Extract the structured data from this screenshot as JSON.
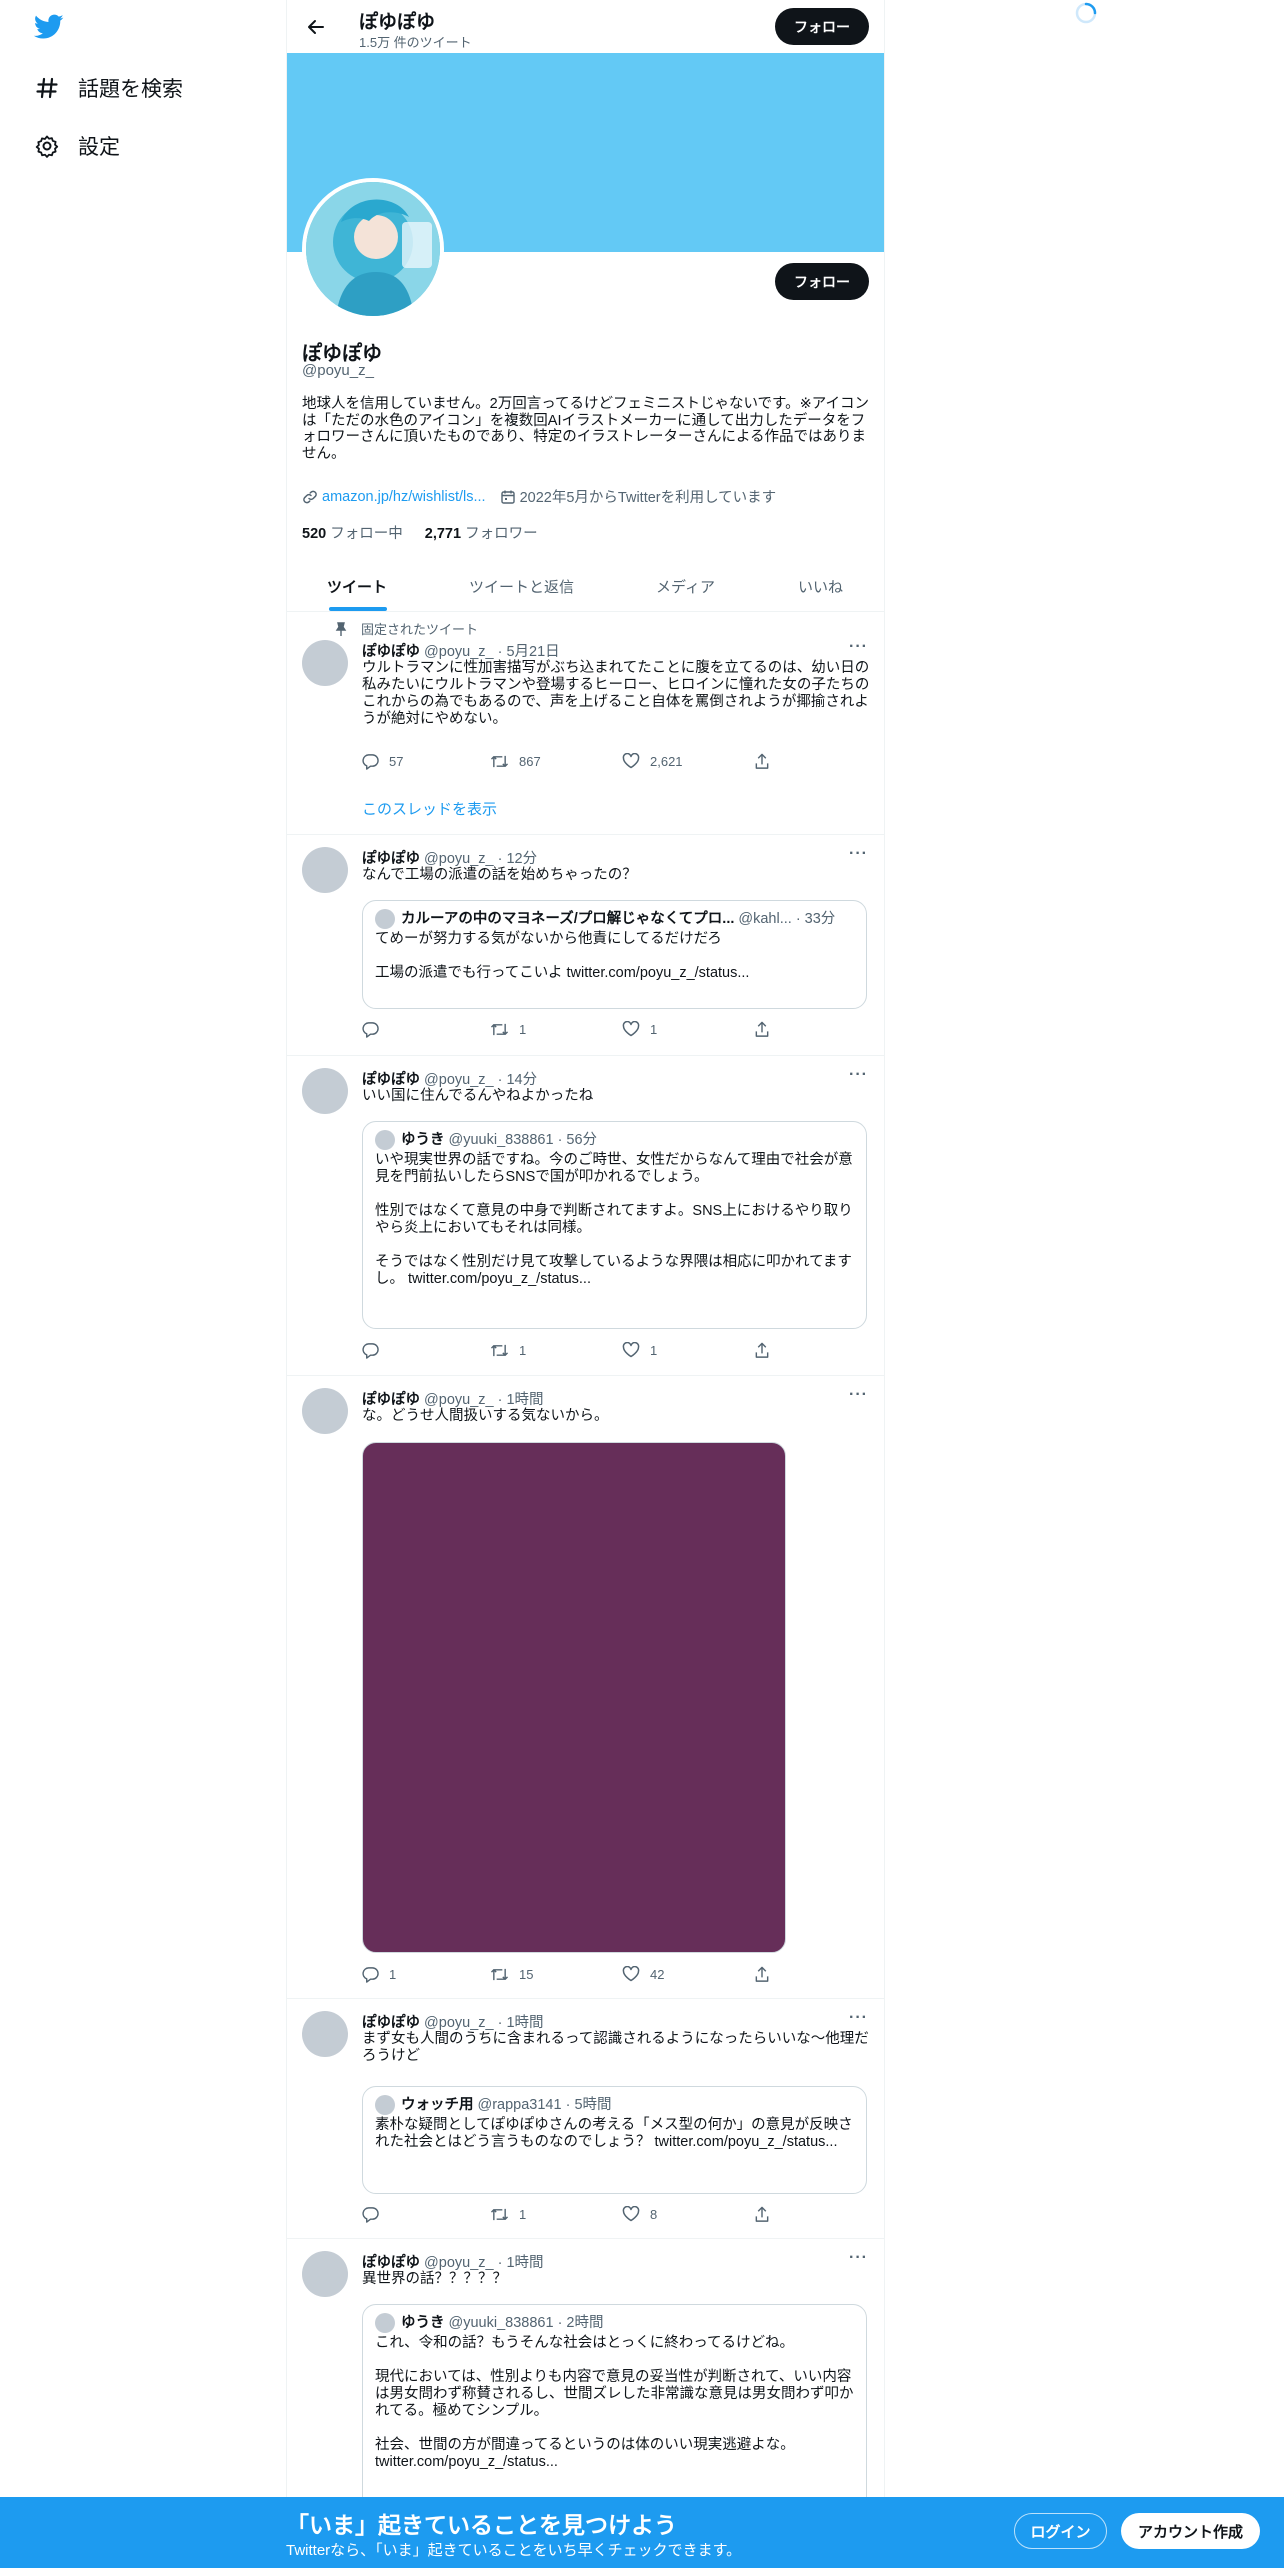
{
  "nav": {
    "explore_label": "話題を検索",
    "settings_label": "設定"
  },
  "header": {
    "name": "ぽゆぽゆ",
    "tweet_count": "1.5万 件のツイート",
    "follow_label": "フォロー"
  },
  "profile": {
    "name": "ぽゆぽゆ",
    "handle": "@poyu_z_",
    "follow_label": "フォロー",
    "bio": "地球人を信用していません。2万回言ってるけどフェミニストじゃないです。※アイコンは「ただの水色のアイコン」を複数回AIイラストメーカーに通して出力したデータをフォロワーさんに頂いたものであり、特定のイラストレーターさんによる作品ではありません。",
    "link": "amazon.jp/hz/wishlist/ls...",
    "joined": "2022年5月からTwitterを利用しています",
    "following_count": "520",
    "following_label": "フォロー中",
    "followers_count": "2,771",
    "followers_label": "フォロワー"
  },
  "tabs": [
    "ツイート",
    "ツイートと返信",
    "メディア",
    "いいね"
  ],
  "tweets": [
    {
      "pinned_label": "固定されたツイート",
      "name": "ぽゆぽゆ",
      "handle": "@poyu_z_",
      "time": "· 5月21日",
      "text": "ウルトラマンに性加害描写がぶち込まれてたことに腹を立てるのは、幼い日の私みたいにウルトラマンや登場するヒーロー、ヒロインに憧れた女の子たちのこれからの為でもあるので、声を上げること自体を罵倒されようが揶揄されようが絶対にやめない。",
      "replies": "57",
      "retweets": "867",
      "likes": "2,621",
      "show_thread": "このスレッドを表示"
    },
    {
      "name": "ぽゆぽゆ",
      "handle": "@poyu_z_",
      "time": "· 12分",
      "text": "なんで工場の派遣の話を始めちゃったの？",
      "quote": {
        "name": "カルーアの中のマヨネーズ/プロ解じゃなくてプロ...",
        "handle": "@kahl...",
        "time": "· 33分",
        "text1": "てめーが努力する気がないから他責にしてるだけだろ",
        "text2": "工場の派遣でも行ってこいよ twitter.com/poyu_z_/status..."
      },
      "replies": "",
      "retweets": "1",
      "likes": "1"
    },
    {
      "name": "ぽゆぽゆ",
      "handle": "@poyu_z_",
      "time": "· 14分",
      "text": "いい国に住んでるんやねよかったね",
      "quote": {
        "name": "ゆうき",
        "handle": "@yuuki_838861",
        "time": "· 56分",
        "text1": "いや現実世界の話ですね。今のご時世、女性だからなんて理由で社会が意見を門前払いしたらSNSで国が叩かれるでしょう。",
        "text2": "性別ではなくて意見の中身で判断されてますよ。SNS上におけるやり取りやら炎上においてもそれは同様。",
        "text3": "そうではなく性別だけ見て攻撃しているような界隈は相応に叩かれてますし。 twitter.com/poyu_z_/status..."
      },
      "replies": "",
      "retweets": "1",
      "likes": "1"
    },
    {
      "name": "ぽゆぽゆ",
      "handle": "@poyu_z_",
      "time": "· 1時間",
      "text": "な。どうせ人間扱いする気ないから。",
      "media_color": "#662e59",
      "replies": "1",
      "retweets": "15",
      "likes": "42"
    },
    {
      "name": "ぽゆぽゆ",
      "handle": "@poyu_z_",
      "time": "· 1時間",
      "text": "まず女も人間のうちに含まれるって認識されるようになったらいいな〜他理だろうけど",
      "quote": {
        "name": "ウォッチ用",
        "handle": "@rappa3141",
        "time": "· 5時間",
        "text1": "素朴な疑問としてぽゆぽゆさんの考える「メス型の何か」の意見が反映された社会とはどう言うものなのでしょう？ twitter.com/poyu_z_/status..."
      },
      "replies": "",
      "retweets": "1",
      "likes": "8"
    },
    {
      "name": "ぽゆぽゆ",
      "handle": "@poyu_z_",
      "time": "· 1時間",
      "text": "異世界の話？？？？？",
      "quote": {
        "name": "ゆうき",
        "handle": "@yuuki_838861",
        "time": "· 2時間",
        "text1": "これ、令和の話？もうそんな社会はとっくに終わってるけどね。",
        "text2": "現代においては、性別よりも内容で意見の妥当性が判断されて、いい内容は男女問わず称賛されるし、世間ズレした非常識な意見は男女問わず叩かれてる。極めてシンプル。",
        "text3": "社会、世間の方が間違ってるというのは体のいい現実逃避よな。 twitter.com/poyu_z_/status..."
      }
    }
  ],
  "bottom_bar": {
    "title": "「いま」起きていることを見つけよう",
    "subtitle": "Twitterなら、「いま」起きていることをいち早くチェックできます。",
    "login_label": "ログイン",
    "signup_label": "アカウント作成"
  },
  "colors": {
    "accent": "#1d9bf0",
    "banner": "#63c9f5",
    "dark_button": "#0f1419"
  }
}
